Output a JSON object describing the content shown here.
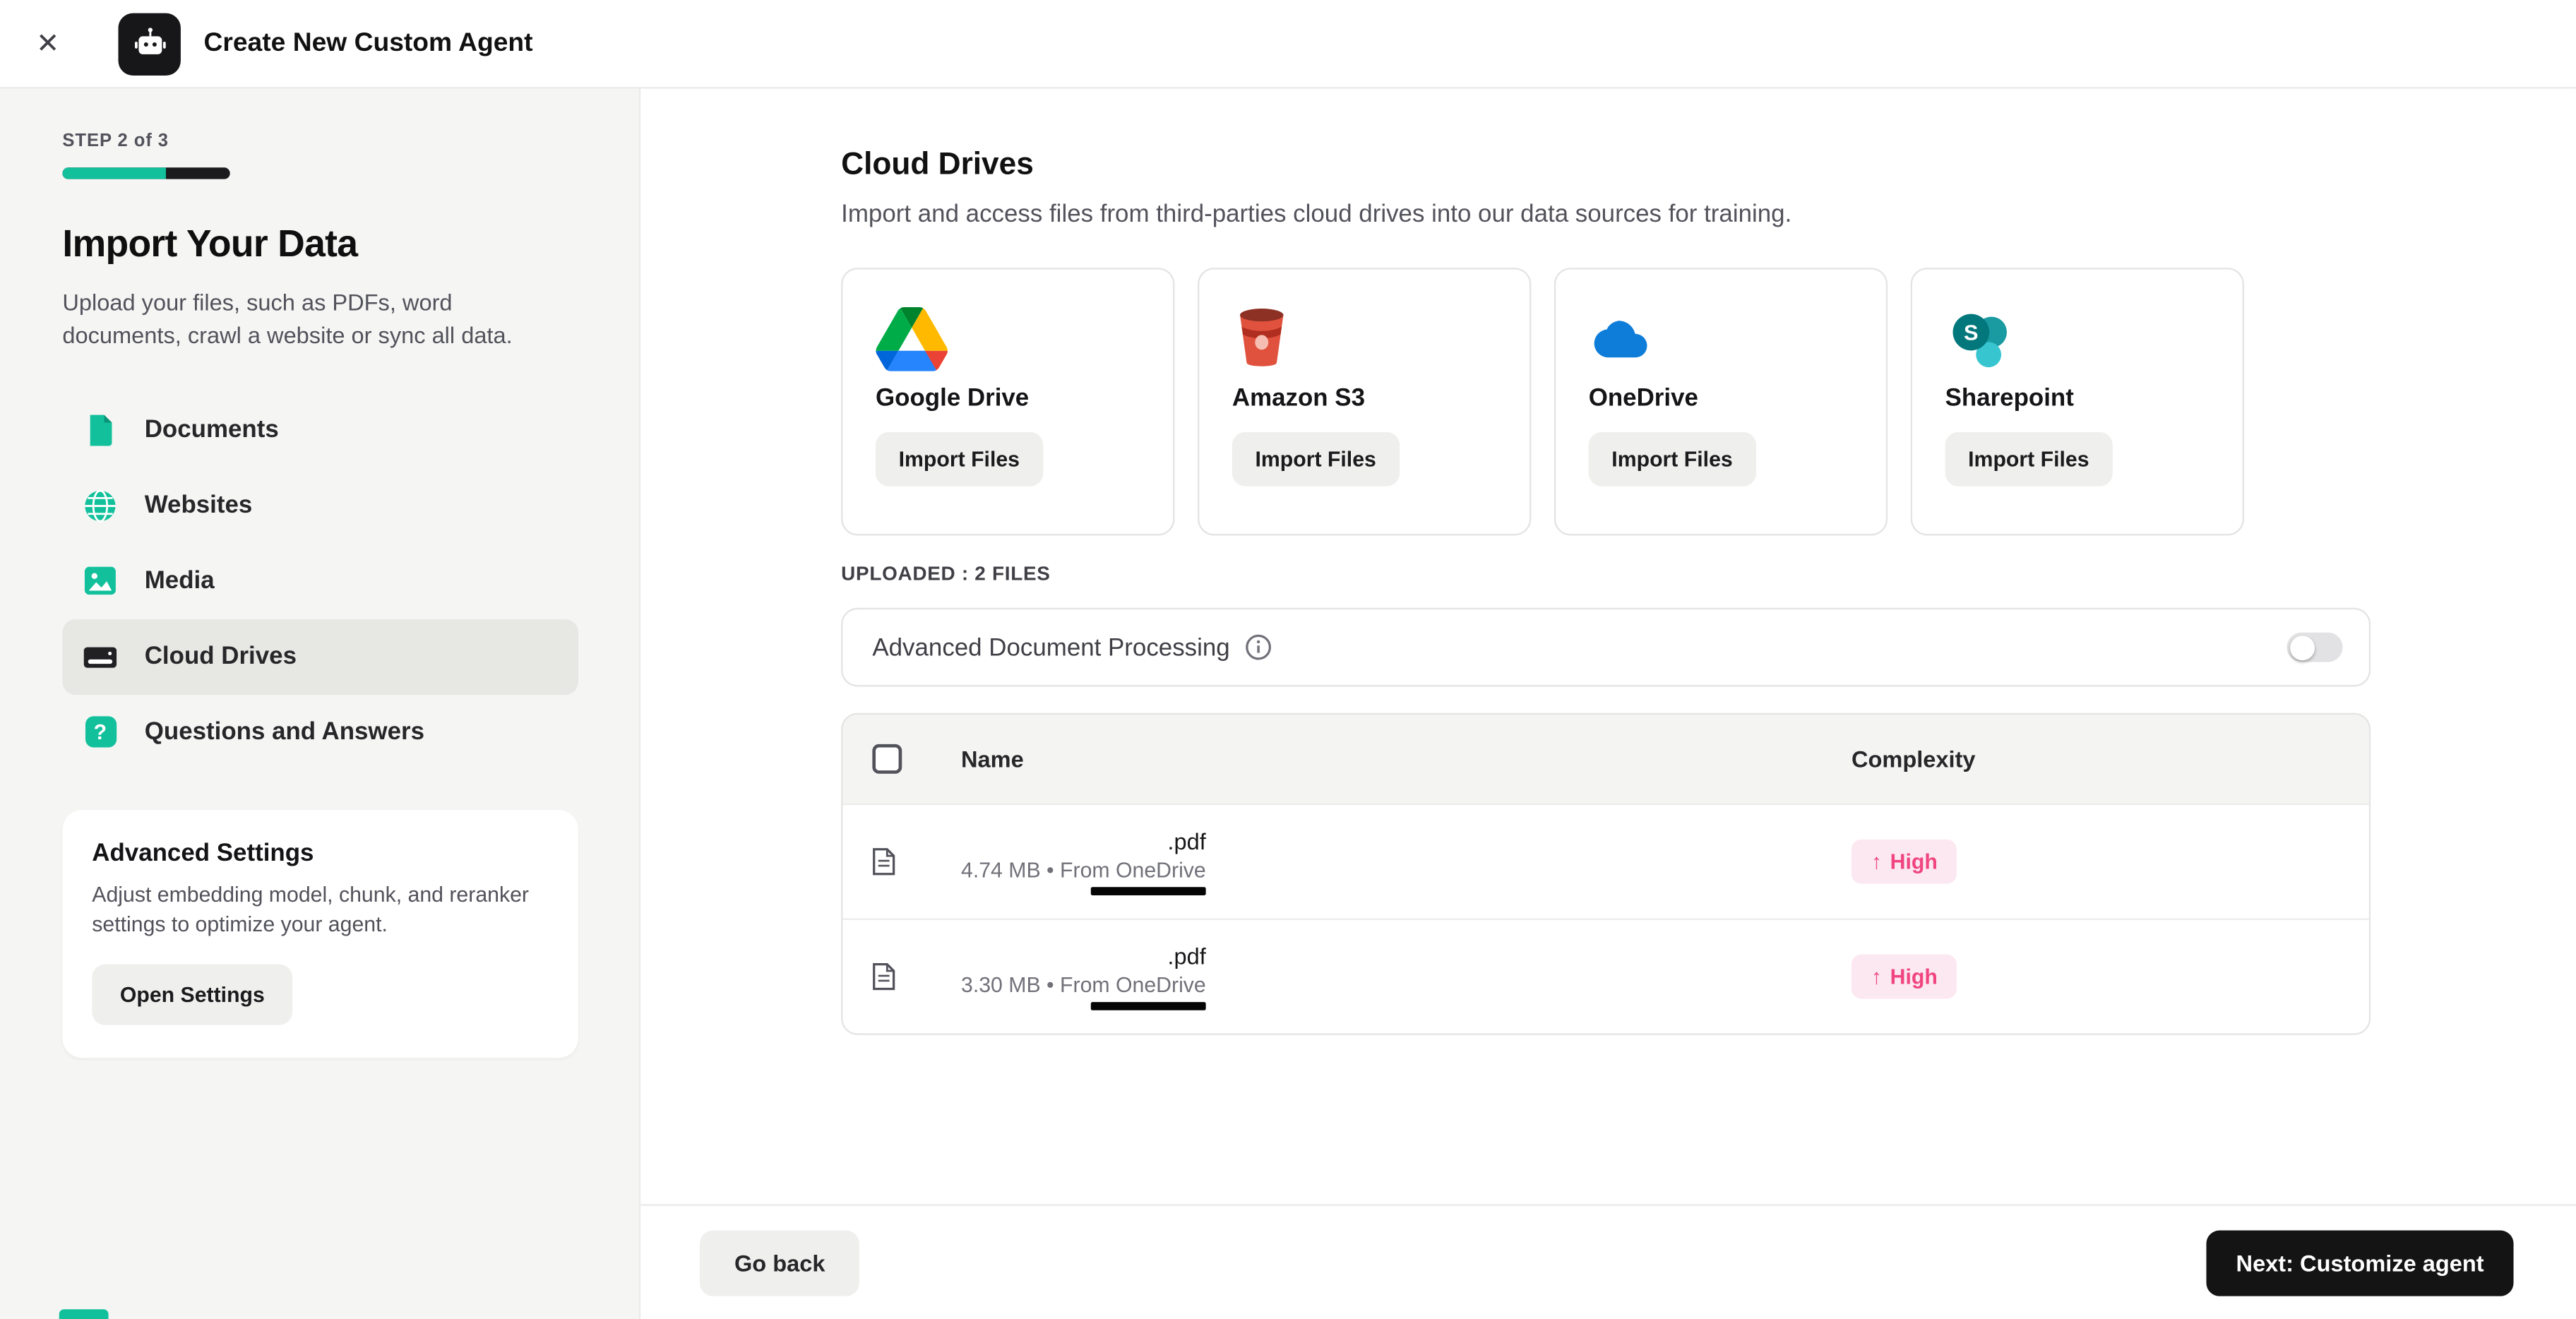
{
  "header": {
    "close_glyph": "✕",
    "title": "Create New Custom Agent"
  },
  "sidebar": {
    "step_label": "STEP 2 of 3",
    "progress_percent": 62,
    "title": "Import Your Data",
    "description": "Upload your files, such as PDFs, word documents, crawl a website or sync all data.",
    "items": [
      {
        "label": "Documents",
        "icon": "document-icon"
      },
      {
        "label": "Websites",
        "icon": "globe-icon"
      },
      {
        "label": "Media",
        "icon": "media-icon"
      },
      {
        "label": "Cloud Drives",
        "icon": "hard-drive-icon",
        "selected": true
      },
      {
        "label": "Questions and Answers",
        "icon": "question-icon"
      }
    ],
    "advanced": {
      "title": "Advanced Settings",
      "description": "Adjust embedding model, chunk, and reranker settings to optimize your agent.",
      "button_label": "Open Settings"
    }
  },
  "main": {
    "title": "Cloud Drives",
    "subtitle": "Import and access files from third-parties cloud drives into our data sources for training.",
    "providers": [
      {
        "name": "Google Drive",
        "button_label": "Import Files",
        "icon": "google-drive-icon"
      },
      {
        "name": "Amazon S3",
        "button_label": "Import Files",
        "icon": "amazon-s3-icon"
      },
      {
        "name": "OneDrive",
        "button_label": "Import Files",
        "icon": "onedrive-icon"
      },
      {
        "name": "Sharepoint",
        "button_label": "Import Files",
        "icon": "sharepoint-icon"
      }
    ],
    "uploaded_label": "UPLOADED : 2 FILES",
    "processing": {
      "label": "Advanced Document Processing",
      "toggle_state": "off"
    },
    "table": {
      "columns": {
        "name": "Name",
        "complexity": "Complexity"
      },
      "arrow": "↑",
      "rows": [
        {
          "ext": ".pdf",
          "meta": "4.74 MB • From OneDrive",
          "complexity": "High"
        },
        {
          "ext": ".pdf",
          "meta": "3.30 MB • From OneDrive",
          "complexity": "High"
        }
      ]
    },
    "footer": {
      "back_label": "Go back",
      "next_label": "Next: Customize agent"
    }
  },
  "colors": {
    "accent_teal": "#12c19c",
    "badge_bg": "#fce8f0",
    "badge_text": "#f0457f",
    "primary_dark": "#141414",
    "sidebar_bg": "#f5f5f4"
  }
}
